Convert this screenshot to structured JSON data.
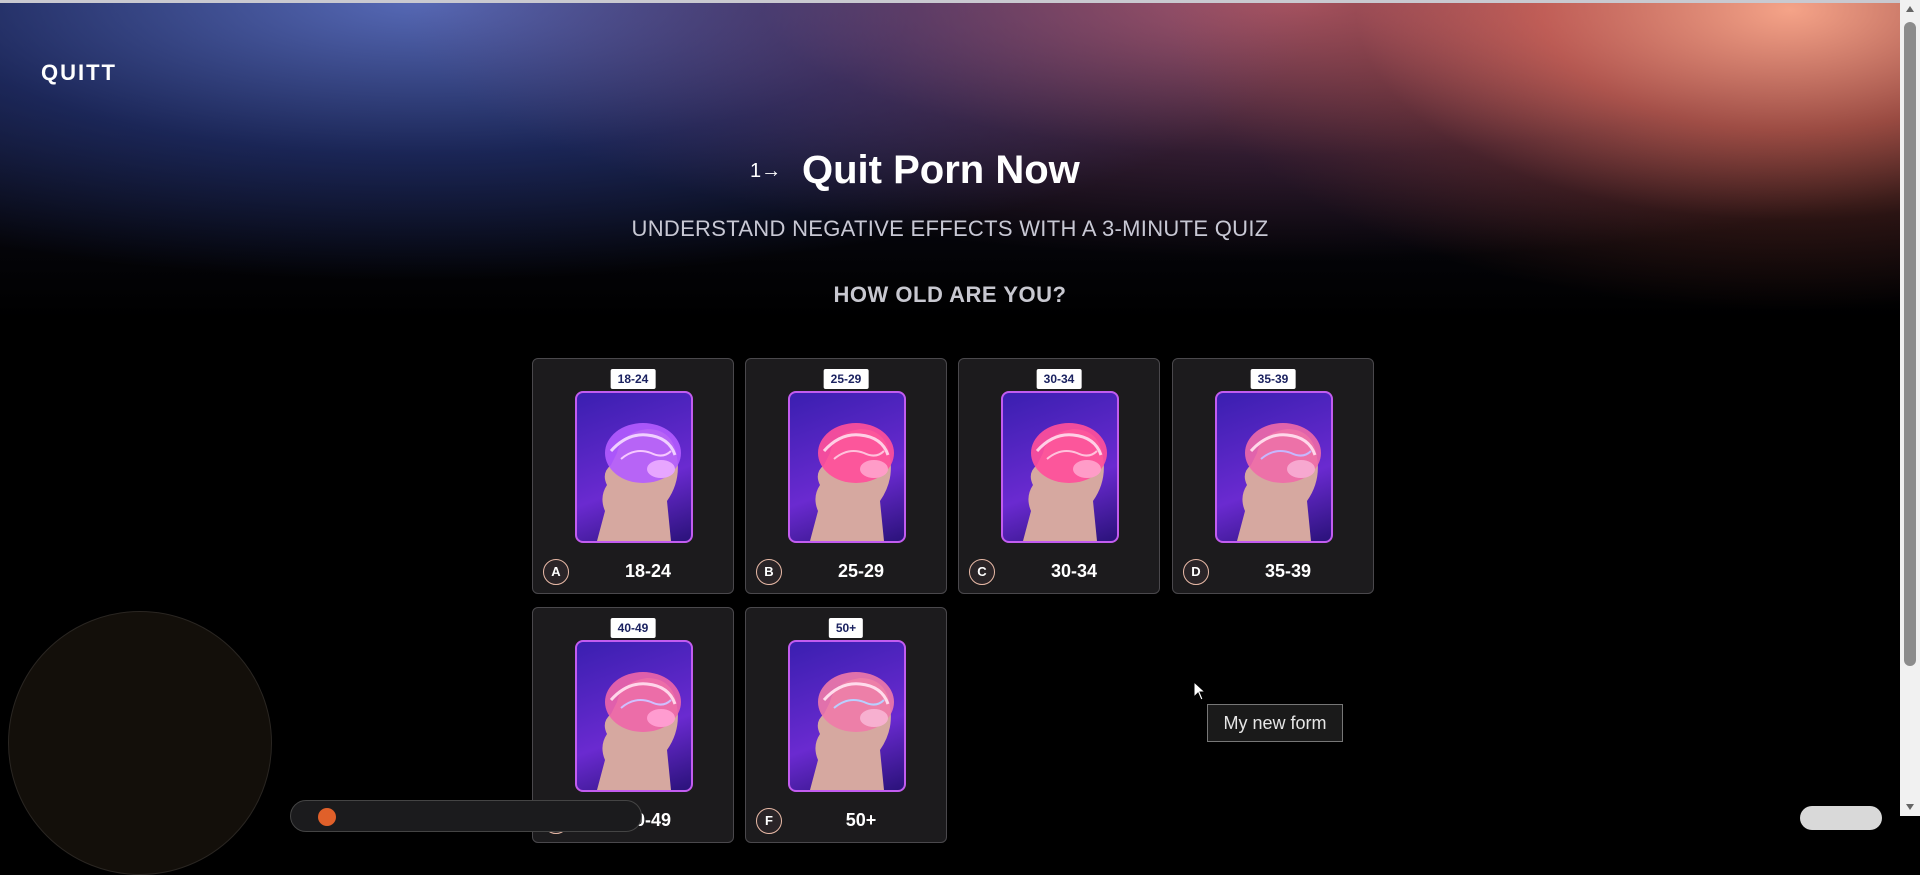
{
  "brand": {
    "logo_text": "QUITT"
  },
  "hero": {
    "step_label": "1→",
    "title": "Quit Porn Now",
    "subtitle": "UNDERSTAND NEGATIVE EFFECTS WITH A 3-MINUTE QUIZ",
    "question": "HOW OLD ARE YOU?"
  },
  "options": [
    {
      "letter": "A",
      "tag": "18-24",
      "label": "18-24",
      "image_icon": "brain-head-icon"
    },
    {
      "letter": "B",
      "tag": "25-29",
      "label": "25-29",
      "image_icon": "brain-head-icon"
    },
    {
      "letter": "C",
      "tag": "30-34",
      "label": "30-34",
      "image_icon": "brain-head-icon"
    },
    {
      "letter": "D",
      "tag": "35-39",
      "label": "35-39",
      "image_icon": "brain-head-icon"
    },
    {
      "letter": "E",
      "tag": "40-49",
      "label": "40-49",
      "image_icon": "brain-head-icon"
    },
    {
      "letter": "F",
      "tag": "50+",
      "label": "50+",
      "image_icon": "brain-head-icon"
    }
  ],
  "tooltip": {
    "text": "My new form"
  },
  "colors": {
    "accent_tag_text": "#1b2260",
    "card_bg": "#1c1b1d",
    "badge_border": "#e8b9a6",
    "brain_pink": "#ff5fa8",
    "brain_purple": "#9b4dff"
  }
}
